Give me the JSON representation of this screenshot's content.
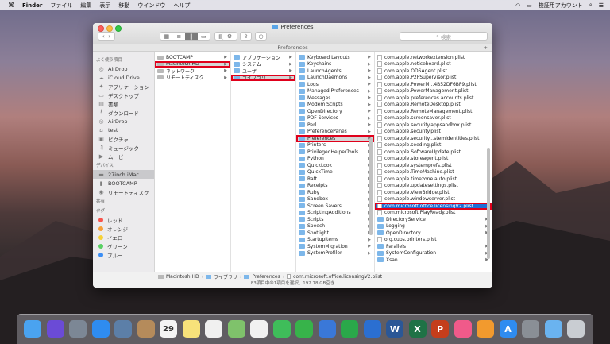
{
  "menubar": {
    "app": "Finder",
    "items": [
      "ファイル",
      "編集",
      "表示",
      "移動",
      "ウインドウ",
      "ヘルプ"
    ],
    "user": "検証用アカウント"
  },
  "window": {
    "title": "Preferences",
    "path_tab": "Preferences",
    "search_placeholder": "検索"
  },
  "sidebar": {
    "favorites_header": "よく使う項目",
    "favorites": [
      {
        "icon": "airdrop-icon",
        "label": "AirDrop"
      },
      {
        "icon": "cloud-icon",
        "label": "iCloud Drive"
      },
      {
        "icon": "applications-icon",
        "label": "アプリケーション"
      },
      {
        "icon": "desktop-icon",
        "label": "デスクトップ"
      },
      {
        "icon": "documents-icon",
        "label": "書類"
      },
      {
        "icon": "downloads-icon",
        "label": "ダウンロード"
      },
      {
        "icon": "airdrop-icon",
        "label": "AirDrop"
      },
      {
        "icon": "home-icon",
        "label": "test"
      },
      {
        "icon": "pictures-icon",
        "label": "ピクチャ"
      },
      {
        "icon": "music-icon",
        "label": "ミュージック"
      },
      {
        "icon": "movies-icon",
        "label": "ムービー"
      }
    ],
    "devices_header": "デバイス",
    "devices": [
      {
        "icon": "imac-icon",
        "label": "27inch iMac"
      },
      {
        "icon": "disk-icon",
        "label": "BOOTCAMP"
      },
      {
        "icon": "remote-disc-icon",
        "label": "リモートディスク"
      }
    ],
    "shared_header": "共有",
    "tags_header": "タグ",
    "tags": [
      {
        "label": "レッド",
        "color": "#f8544d"
      },
      {
        "label": "オレンジ",
        "color": "#f7a03a"
      },
      {
        "label": "イエロー",
        "color": "#f6d237"
      },
      {
        "label": "グリーン",
        "color": "#5ad064"
      },
      {
        "label": "ブルー",
        "color": "#3b8ef5"
      }
    ]
  },
  "columns": {
    "col1": [
      {
        "label": "BOOTCAMP",
        "type": "disk"
      },
      {
        "label": "Macintosh HD",
        "type": "disk",
        "state": "gsel",
        "highlight": true
      },
      {
        "label": "ネットワーク",
        "type": "net"
      },
      {
        "label": "リモートディスク",
        "type": "disc"
      }
    ],
    "col2": [
      {
        "label": "アプリケーション",
        "type": "folder"
      },
      {
        "label": "システム",
        "type": "folder"
      },
      {
        "label": "ユーザ",
        "type": "folder"
      },
      {
        "label": "ライブラリ",
        "type": "folder",
        "state": "gsel",
        "highlight": true
      }
    ],
    "col3": [
      {
        "label": "Keyboard Layouts",
        "type": "folder"
      },
      {
        "label": "Keychains",
        "type": "folder"
      },
      {
        "label": "LaunchAgents",
        "type": "folder"
      },
      {
        "label": "LaunchDaemons",
        "type": "folder"
      },
      {
        "label": "Logs",
        "type": "folder"
      },
      {
        "label": "Managed Preferences",
        "type": "folder"
      },
      {
        "label": "Messages",
        "type": "folder"
      },
      {
        "label": "Modem Scripts",
        "type": "folder"
      },
      {
        "label": "OpenDirectory",
        "type": "folder"
      },
      {
        "label": "PDF Services",
        "type": "folder"
      },
      {
        "label": "Perl",
        "type": "folder"
      },
      {
        "label": "PreferencePanes",
        "type": "folder"
      },
      {
        "label": "Preferences",
        "type": "folder",
        "state": "gsel",
        "highlight": true
      },
      {
        "label": "Printers",
        "type": "folder"
      },
      {
        "label": "PrivilegedHelperTools",
        "type": "folder"
      },
      {
        "label": "Python",
        "type": "folder"
      },
      {
        "label": "QuickLook",
        "type": "folder"
      },
      {
        "label": "QuickTime",
        "type": "folder"
      },
      {
        "label": "Raft",
        "type": "folder"
      },
      {
        "label": "Receipts",
        "type": "folder"
      },
      {
        "label": "Ruby",
        "type": "folder"
      },
      {
        "label": "Sandbox",
        "type": "folder"
      },
      {
        "label": "Screen Savers",
        "type": "folder"
      },
      {
        "label": "ScriptingAdditions",
        "type": "folder"
      },
      {
        "label": "Scripts",
        "type": "folder"
      },
      {
        "label": "Speech",
        "type": "folder"
      },
      {
        "label": "Spotlight",
        "type": "folder"
      },
      {
        "label": "StartupItems",
        "type": "folder"
      },
      {
        "label": "SystemMigration",
        "type": "folder"
      },
      {
        "label": "SystemProfiler",
        "type": "folder"
      }
    ],
    "col4": [
      {
        "label": "com.apple.networkextension.plist",
        "type": "doc"
      },
      {
        "label": "com.apple.noticeboard.plist",
        "type": "doc"
      },
      {
        "label": "com.apple.ODSAgent.plist",
        "type": "doc"
      },
      {
        "label": "com.apple.P2PSupervisor.plist",
        "type": "doc"
      },
      {
        "label": "com.apple.PowerM...4B52DF6BF9.plist",
        "type": "doc"
      },
      {
        "label": "com.apple.PowerManagement.plist",
        "type": "doc"
      },
      {
        "label": "com.apple.preferences.accounts.plist",
        "type": "doc"
      },
      {
        "label": "com.apple.RemoteDesktop.plist",
        "type": "doc"
      },
      {
        "label": "com.apple.RemoteManagement.plist",
        "type": "doc"
      },
      {
        "label": "com.apple.screensaver.plist",
        "type": "doc"
      },
      {
        "label": "com.apple.security.appsandbox.plist",
        "type": "doc"
      },
      {
        "label": "com.apple.security.plist",
        "type": "doc"
      },
      {
        "label": "com.apple.security...stemidentities.plist",
        "type": "doc"
      },
      {
        "label": "com.apple.seeding.plist",
        "type": "doc"
      },
      {
        "label": "com.apple.SoftwareUpdate.plist",
        "type": "doc"
      },
      {
        "label": "com.apple.storeagent.plist",
        "type": "doc"
      },
      {
        "label": "com.apple.systemprefs.plist",
        "type": "doc"
      },
      {
        "label": "com.apple.TimeMachine.plist",
        "type": "doc"
      },
      {
        "label": "com.apple.timezone.auto.plist",
        "type": "doc"
      },
      {
        "label": "com.apple.updatesettings.plist",
        "type": "doc"
      },
      {
        "label": "com.apple.ViewBridge.plist",
        "type": "doc"
      },
      {
        "label": "com.apple.windowserver.plist",
        "type": "doc"
      },
      {
        "label": "com.microsoft.office.licensingV2.plist",
        "type": "doc",
        "state": "sel",
        "highlight": true
      },
      {
        "label": "com.microsoft.PlayReady.plist",
        "type": "doc"
      },
      {
        "label": "DirectoryService",
        "type": "folder"
      },
      {
        "label": "Logging",
        "type": "folder"
      },
      {
        "label": "OpenDirectory",
        "type": "folder"
      },
      {
        "label": "org.cups.printers.plist",
        "type": "doc"
      },
      {
        "label": "Parallels",
        "type": "folder"
      },
      {
        "label": "SystemConfiguration",
        "type": "folder"
      },
      {
        "label": "Xsan",
        "type": "folder"
      }
    ]
  },
  "pathbar": [
    "Macintosh HD",
    "ライブラリ",
    "Preferences",
    "com.microsoft.office.licensingV2.plist"
  ],
  "status": "83項目中の1項目を選択、192.78 GB空き",
  "dock": [
    {
      "name": "finder-icon",
      "color": "#4aa3f0",
      "glyph": ""
    },
    {
      "name": "siri-icon",
      "color": "#6b4bd6",
      "glyph": ""
    },
    {
      "name": "launchpad-icon",
      "color": "#7c8795",
      "glyph": ""
    },
    {
      "name": "safari-icon",
      "color": "#2f8cf0",
      "glyph": ""
    },
    {
      "name": "photos-app-icon",
      "color": "#5c7fa8",
      "glyph": ""
    },
    {
      "name": "contacts-icon",
      "color": "#b58b5b",
      "glyph": ""
    },
    {
      "name": "calendar-icon",
      "color": "#f4f4f4",
      "glyph": "29"
    },
    {
      "name": "notes-icon",
      "color": "#f7e27a",
      "glyph": ""
    },
    {
      "name": "reminders-icon",
      "color": "#f0f0f0",
      "glyph": ""
    },
    {
      "name": "maps-icon",
      "color": "#7fc26b",
      "glyph": ""
    },
    {
      "name": "photos-icon",
      "color": "#f1f1f1",
      "glyph": ""
    },
    {
      "name": "messages-icon",
      "color": "#3fbd5a",
      "glyph": ""
    },
    {
      "name": "facetime-icon",
      "color": "#37b34a",
      "glyph": ""
    },
    {
      "name": "keynote-icon",
      "color": "#3a78d8",
      "glyph": ""
    },
    {
      "name": "numbers-icon",
      "color": "#2aa84a",
      "glyph": ""
    },
    {
      "name": "keynote-2-icon",
      "color": "#2b6fd1",
      "glyph": ""
    },
    {
      "name": "word-icon",
      "color": "#2b5796",
      "glyph": "W"
    },
    {
      "name": "excel-icon",
      "color": "#1f7246",
      "glyph": "X"
    },
    {
      "name": "powerpoint-icon",
      "color": "#c43e1c",
      "glyph": "P"
    },
    {
      "name": "itunes-icon",
      "color": "#f05a8a",
      "glyph": ""
    },
    {
      "name": "ibooks-icon",
      "color": "#f29a2e",
      "glyph": ""
    },
    {
      "name": "appstore-icon",
      "color": "#2f8cf0",
      "glyph": "A"
    },
    {
      "name": "system-preferences-icon",
      "color": "#8a8f96",
      "glyph": ""
    },
    {
      "name": "downloads-folder-icon",
      "color": "#6ab3f0",
      "glyph": ""
    },
    {
      "name": "trash-icon",
      "color": "#c9cdd2",
      "glyph": ""
    }
  ]
}
